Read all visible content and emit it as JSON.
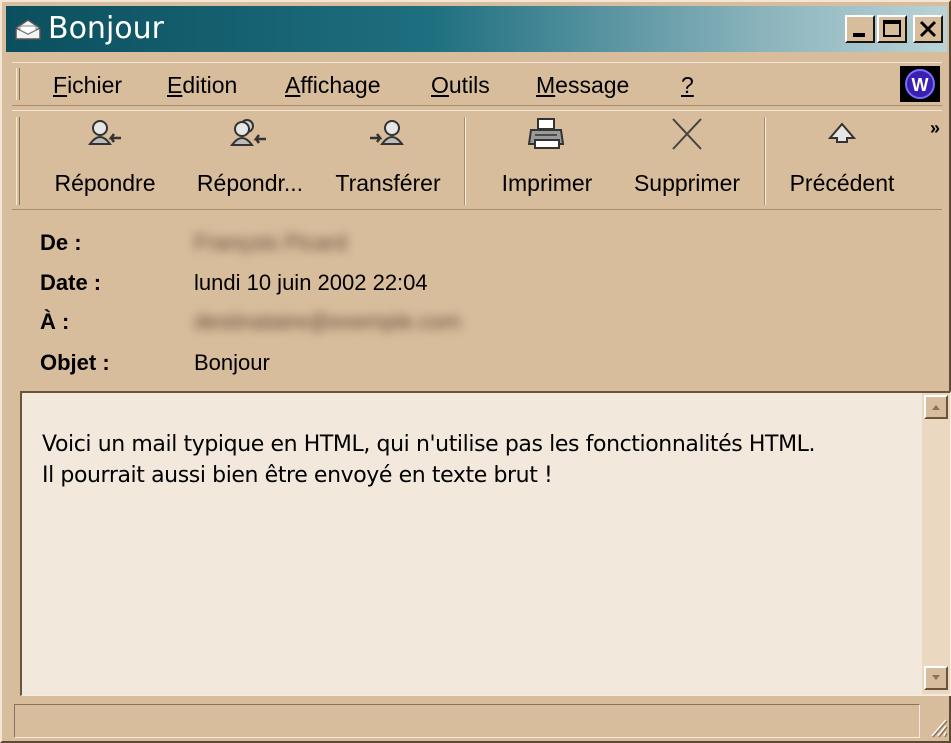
{
  "window": {
    "title": "Bonjour",
    "controls": {
      "minimize": "minimize-button",
      "maximize": "maximize-button",
      "close": "close-button"
    },
    "title_gradient": [
      "#0b4f5e",
      "#b9d3d8"
    ]
  },
  "menu": {
    "items": [
      {
        "label": "Fichier",
        "accel": "F",
        "rest": "ichier"
      },
      {
        "label": "Edition",
        "accel": "E",
        "rest": "dition"
      },
      {
        "label": "Affichage",
        "accel": "A",
        "rest": "ffichage"
      },
      {
        "label": "Outils",
        "accel": "O",
        "rest": "utils"
      },
      {
        "label": "Message",
        "accel": "M",
        "rest": "essage"
      },
      {
        "label": "?",
        "accel": "?",
        "rest": ""
      }
    ]
  },
  "toolbar": {
    "buttons": [
      {
        "label": "Répondre",
        "icon": "reply-icon"
      },
      {
        "label": "Répondr...",
        "icon": "reply-all-icon"
      },
      {
        "label": "Transférer",
        "icon": "forward-icon"
      },
      {
        "label": "Imprimer",
        "icon": "printer-icon"
      },
      {
        "label": "Supprimer",
        "icon": "delete-icon"
      },
      {
        "label": "Précédent",
        "icon": "previous-icon"
      }
    ],
    "overflow": "»"
  },
  "header": {
    "from_label": "De :",
    "from_value": "François Picard",
    "date_label": "Date :",
    "date_value": "lundi 10 juin 2002 22:04",
    "to_label": "À :",
    "to_value": "destinataire@exemple.com",
    "subject_label": "Objet :",
    "subject_value": "Bonjour"
  },
  "message": {
    "line1": "Voici un mail typique en HTML, qui n'utilise pas les fonctionnalités HTML.",
    "line2": "Il pourrait aussi bien être envoyé en texte brut !"
  },
  "status": {
    "text": ""
  },
  "colors": {
    "chrome": "#d8bd9c",
    "body_bg": "#f2e9dc",
    "accent": "#0b4f5e"
  }
}
